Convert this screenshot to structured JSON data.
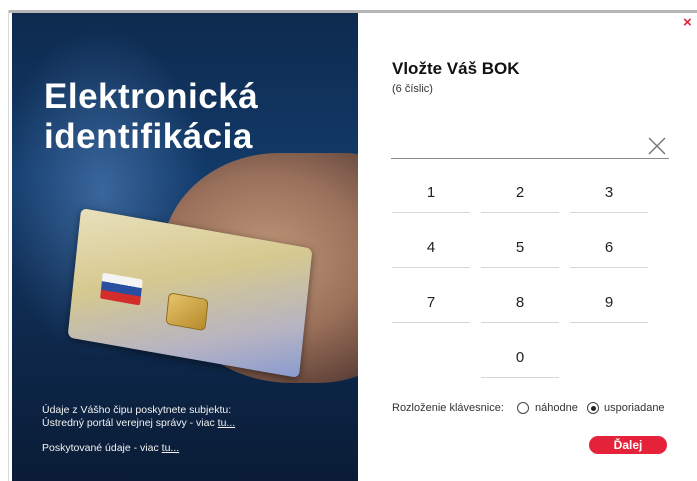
{
  "hero": {
    "title_line1": "Elektronická",
    "title_line2": "identifikácia",
    "info_line1": "Údaje z Vášho čipu poskytnete subjektu:",
    "info_line2_prefix": "Ústredný portál verejnej správy - viac",
    "info_link": "tu...",
    "provided_prefix": "Poskytované údaje - viac",
    "provided_link": "tu..."
  },
  "form": {
    "title": "Vložte Váš BOK",
    "subtitle": "(6 číslic)",
    "close_symbol": "×",
    "pin_value": "",
    "keys": [
      "1",
      "2",
      "3",
      "4",
      "5",
      "6",
      "7",
      "8",
      "9",
      "0"
    ],
    "layout_label": "Rozloženie klávesnice:",
    "layout_options": [
      {
        "label": "náhodne",
        "selected": false
      },
      {
        "label": "usporiadane",
        "selected": true
      }
    ],
    "next_label": "Ďalej"
  },
  "colors": {
    "accent": "#e4223a",
    "hero_bg": "#123a69"
  },
  "icons": {
    "close": "close-icon",
    "clear": "clear-icon"
  }
}
